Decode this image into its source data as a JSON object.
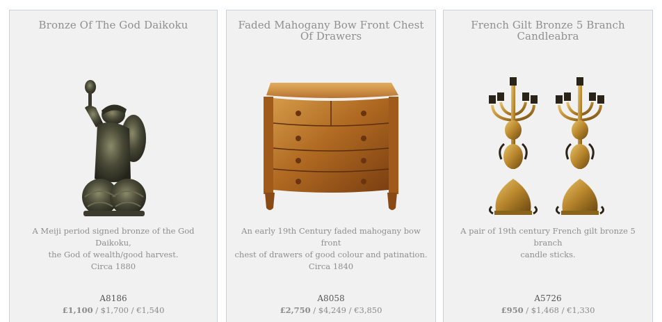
{
  "products": [
    {
      "title": "Bronze Of The God Daikoku",
      "image": "bronze-daikoku-statue",
      "description": [
        "A Meiji period signed bronze of the God Daikoku,",
        "the God of wealth/good harvest.",
        "Circa 1880"
      ],
      "ref": "A8186",
      "price_gbp": "£1,100",
      "price_other": " / $1,700 / €1,540"
    },
    {
      "title": "Faded Mahogany Bow Front Chest Of Drawers",
      "image": "mahogany-chest-of-drawers",
      "description": [
        "An early 19th Century faded mahogany bow front",
        "chest of drawers of good colour and patination.",
        "Circa 1840"
      ],
      "ref": "A8058",
      "price_gbp": "£2,750",
      "price_other": " / $4,249 / €3,850"
    },
    {
      "title": "French Gilt Bronze 5 Branch Candleabra",
      "image": "gilt-bronze-candelabra-pair",
      "description": [
        "A pair of 19th century French gilt bronze 5 branch",
        "candle sticks.",
        ""
      ],
      "ref": "A5726",
      "price_gbp": "£950",
      "price_other": " / $1,468 / €1,330"
    }
  ]
}
